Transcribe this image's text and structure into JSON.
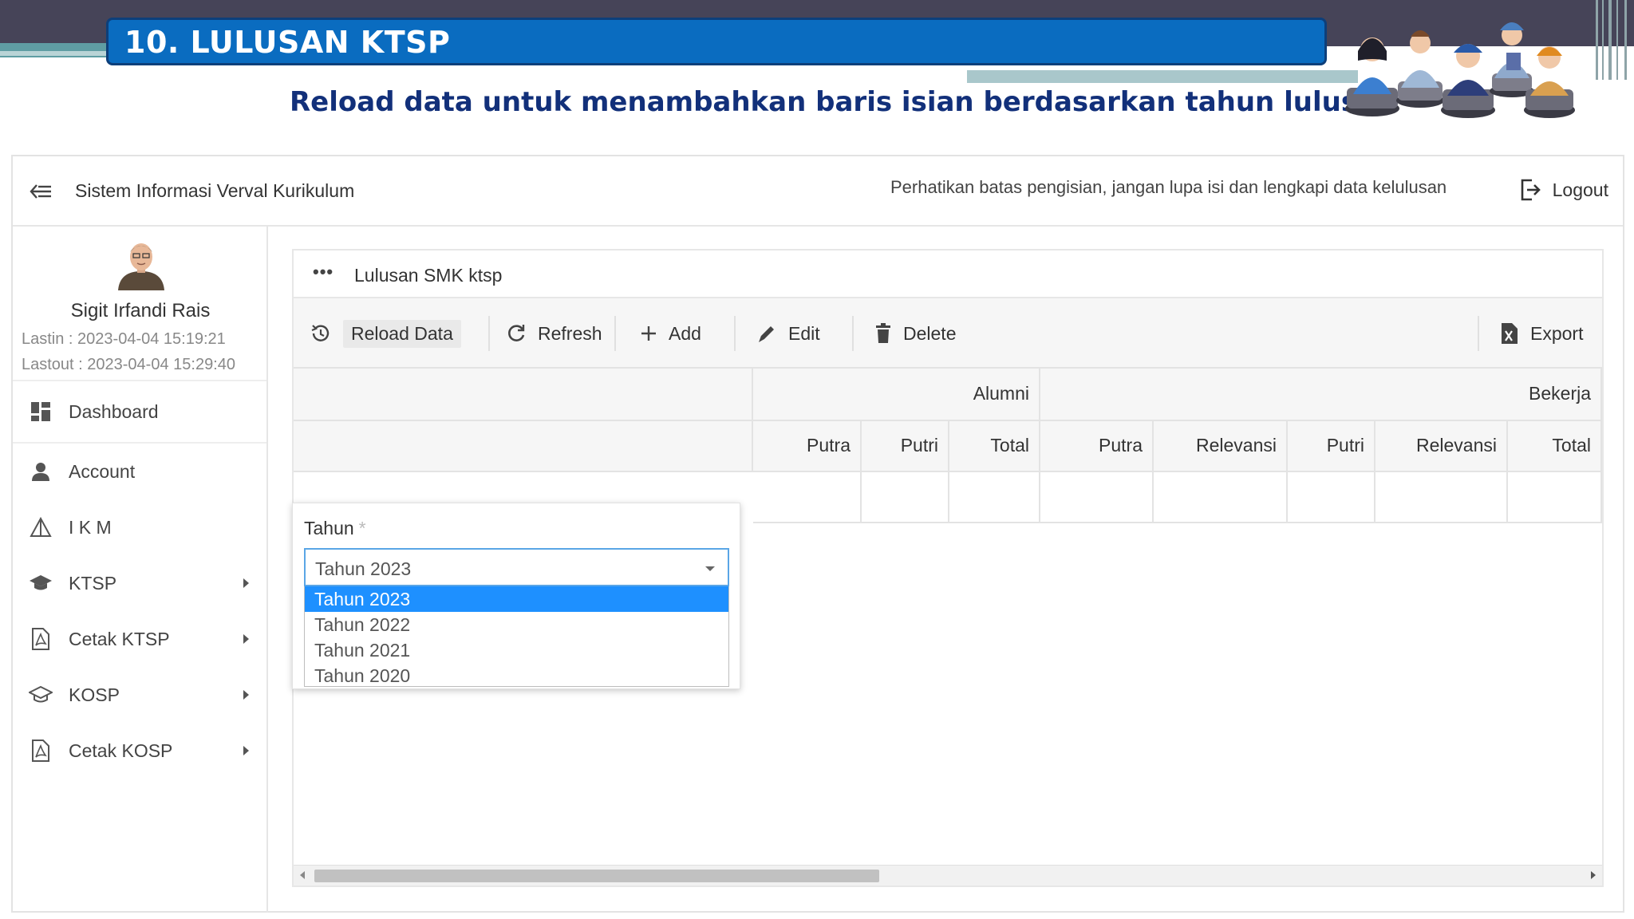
{
  "slide": {
    "title": "10. LULUSAN KTSP",
    "subtitle": "Reload data untuk menambahkan baris isian berdasarkan tahun lulusan",
    "colors": {
      "title_bar": "#0a6cc0",
      "subtitle": "#12307a",
      "top_band": "#464458"
    }
  },
  "header": {
    "app_title": "Sistem Informasi Verval Kurikulum",
    "notice": "Perhatikan batas pengisian, jangan lupa isi dan lengkapi data kelulusan",
    "logout_label": "Logout"
  },
  "user": {
    "name": "Sigit Irfandi Rais",
    "lastin": "Lastin : 2023-04-04 15:19:21",
    "lastout": "Lastout : 2023-04-04 15:29:40"
  },
  "sidebar": {
    "items": [
      {
        "label": "Dashboard",
        "icon": "dashboard-icon",
        "submenu": false
      },
      {
        "label": "Account",
        "icon": "user-icon",
        "submenu": false
      },
      {
        "label": "I K M",
        "icon": "ikm-icon",
        "submenu": false
      },
      {
        "label": "KTSP",
        "icon": "graduation-cap-icon",
        "submenu": true
      },
      {
        "label": "Cetak KTSP",
        "icon": "pdf-file-icon",
        "submenu": true
      },
      {
        "label": "KOSP",
        "icon": "graduation-cap-outline-icon",
        "submenu": true
      },
      {
        "label": "Cetak KOSP",
        "icon": "pdf-file-icon",
        "submenu": true
      }
    ]
  },
  "panel": {
    "title": "Lulusan SMK ktsp",
    "toolbar": {
      "reload": "Reload Data",
      "refresh": "Refresh",
      "add": "Add",
      "edit": "Edit",
      "delete": "Delete",
      "export": "Export"
    },
    "table": {
      "group_headers": [
        "Alumni",
        "Bekerja"
      ],
      "columns": [
        "Putra",
        "Putri",
        "Total",
        "Putra",
        "Relevansi",
        "Putri",
        "Relevansi",
        "Total"
      ],
      "rows": [
        [
          "",
          "",
          "",
          "",
          "",
          "",
          "",
          ""
        ]
      ]
    }
  },
  "form": {
    "label": "Tahun",
    "required_mark": "*",
    "selected": "Tahun 2023",
    "options": [
      "Tahun 2023",
      "Tahun 2022",
      "Tahun 2021",
      "Tahun 2020"
    ]
  }
}
